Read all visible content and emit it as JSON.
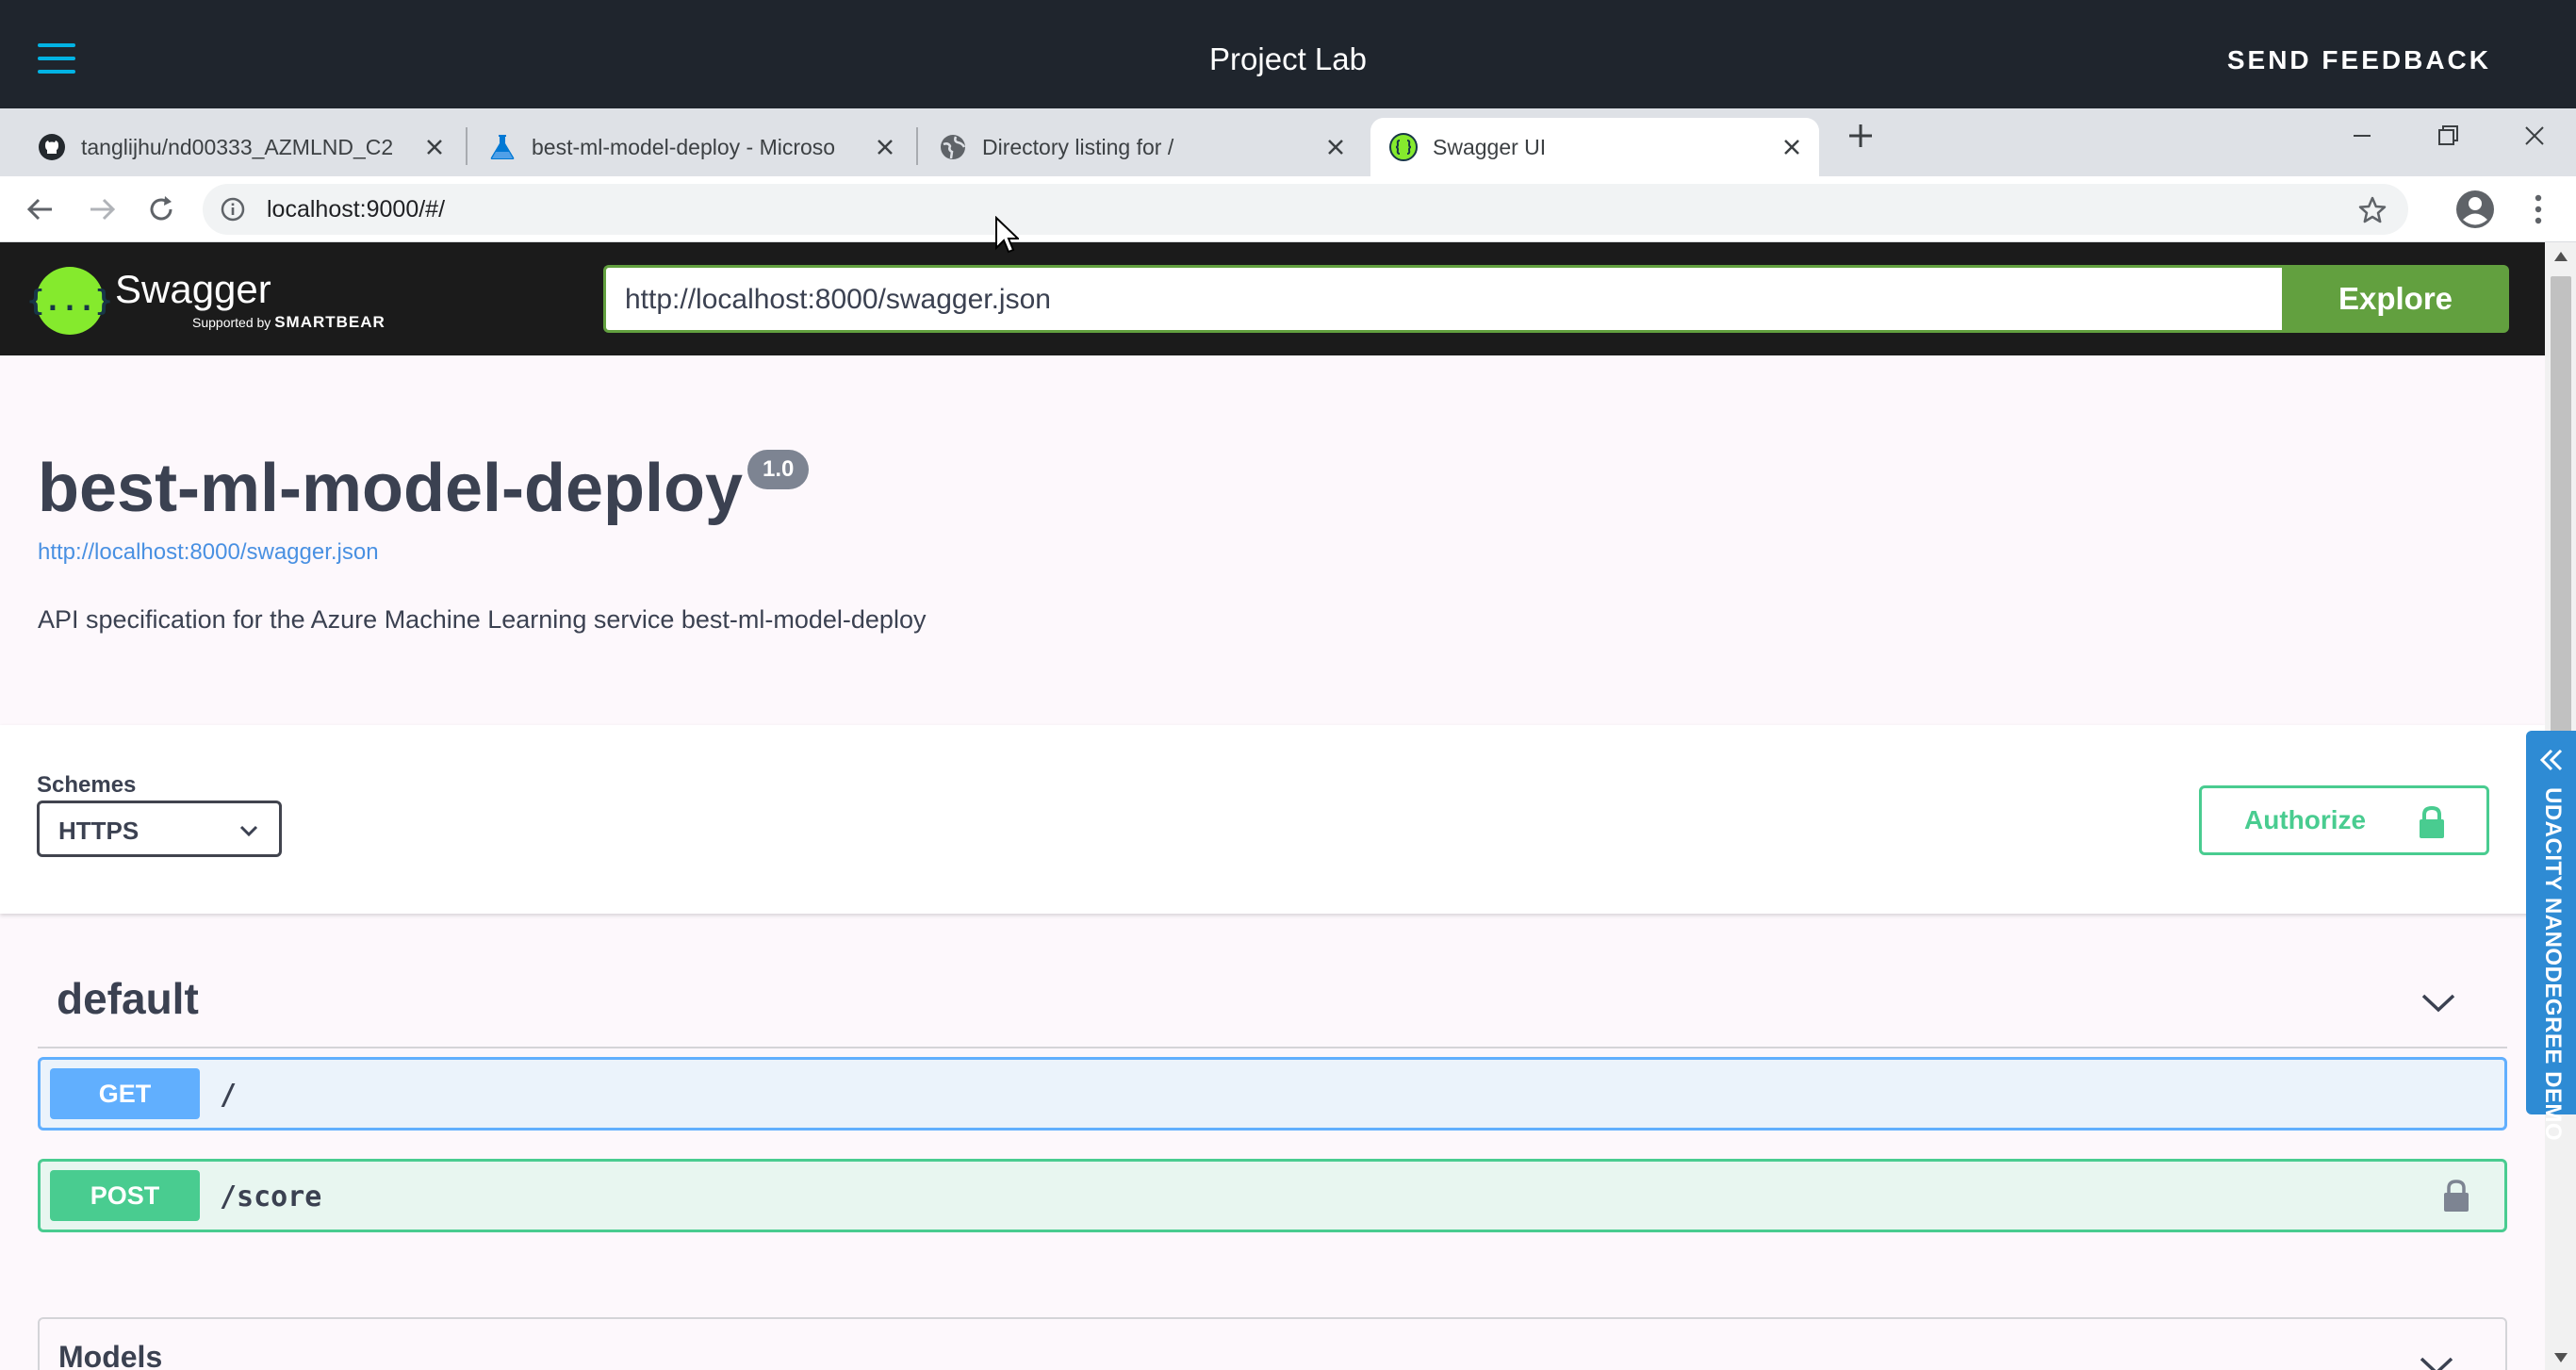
{
  "lab_header": {
    "title": "Project Lab",
    "feedback_label": "SEND FEEDBACK"
  },
  "browser": {
    "tabs": [
      {
        "title": "tanglijhu/nd00333_AZMLND_C2",
        "icon": "github-icon"
      },
      {
        "title": "best-ml-model-deploy - Microso",
        "icon": "azure-ml-flask-icon"
      },
      {
        "title": "Directory listing for /",
        "icon": "globe-icon"
      },
      {
        "title": "Swagger UI",
        "icon": "swagger-favicon"
      }
    ],
    "active_tab_index": 3,
    "address": "localhost:9000/#/"
  },
  "swagger": {
    "logo_text": "Swagger",
    "logo_sub_prefix": "Supported by",
    "logo_sub_brand": "SMARTBEAR",
    "logo_brace": "{...}",
    "spec_url_input": "http://localhost:8000/swagger.json",
    "explore_label": "Explore",
    "api_title": "best-ml-model-deploy",
    "version": "1.0",
    "spec_link": "http://localhost:8000/swagger.json",
    "description": "API specification for the Azure Machine Learning service best-ml-model-deploy",
    "schemes_label": "Schemes",
    "scheme_selected": "HTTPS",
    "authorize_label": "Authorize",
    "tag_name": "default",
    "operations": [
      {
        "method": "GET",
        "path": "/"
      },
      {
        "method": "POST",
        "path": "/score"
      }
    ],
    "models_label": "Models",
    "colors": {
      "get": "#61affe",
      "post": "#49cc90",
      "explore": "#62a03f",
      "topbar": "#1b1b1b"
    }
  },
  "side_tab": {
    "label": "UDACITY NANODEGREE DEMO"
  }
}
